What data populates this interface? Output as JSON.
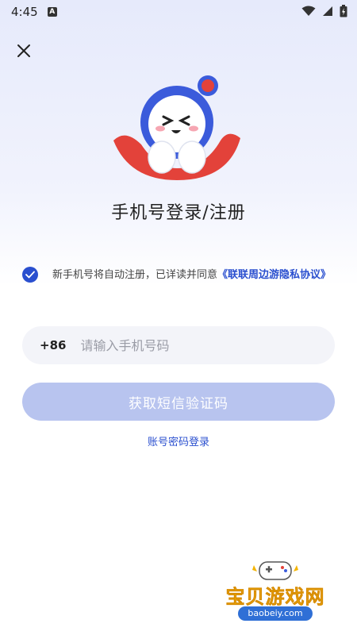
{
  "status_bar": {
    "time": "4:45",
    "app_icon_letter": "A",
    "icons": [
      "wifi-icon",
      "signal-icon",
      "battery-icon"
    ]
  },
  "header": {
    "close_icon": "close-icon"
  },
  "main": {
    "title": "手机号登录/注册",
    "agreement_prefix": "新手机号将自动注册，已详读并同意",
    "agreement_link": "《联联周边游隐私协议》",
    "agreement_checked": true,
    "country_code": "+86",
    "phone_placeholder": "请输入手机号码",
    "phone_value": "",
    "get_code_label": "获取短信验证码",
    "account_login_label": "账号密码登录"
  },
  "watermark": {
    "title": "宝贝游戏网",
    "url": "baobeiy.com"
  },
  "colors": {
    "accent": "#2a4fcf",
    "button_disabled": "#b8c4ef",
    "mascot_red": "#e3423a",
    "mascot_blue": "#3b5bdb"
  }
}
